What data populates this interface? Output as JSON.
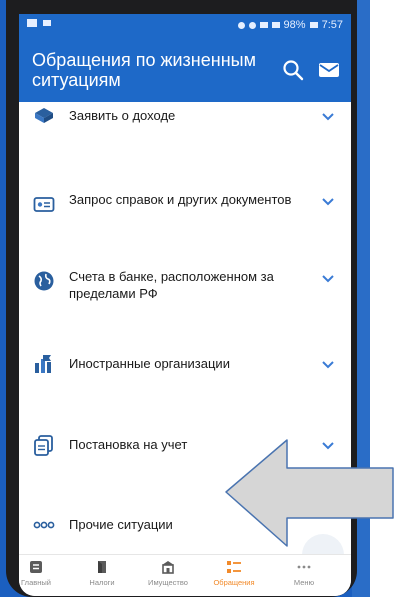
{
  "status_bar": {
    "battery": "98%",
    "time": "7:57"
  },
  "app_bar": {
    "title": "Обращения по жизненным ситуациям"
  },
  "items": [
    {
      "label": "Заявить о доходе",
      "icon": "coin-stack-icon"
    },
    {
      "label": "Запрос справок и других документов",
      "icon": "id-card-icon"
    },
    {
      "label": "Счета в банке, расположенном за пределами РФ",
      "icon": "globe-icon"
    },
    {
      "label": "Иностранные организации",
      "icon": "flag-building-icon"
    },
    {
      "label": "Постановка на учет",
      "icon": "document-copy-icon"
    },
    {
      "label": "Прочие ситуации",
      "icon": "more-dots-icon"
    }
  ],
  "tabs": [
    {
      "label": "Главный",
      "icon": "home-icon",
      "active": false
    },
    {
      "label": "Налоги",
      "icon": "tax-icon",
      "active": false
    },
    {
      "label": "Имущество",
      "icon": "property-icon",
      "active": false
    },
    {
      "label": "Обращения",
      "icon": "requests-icon",
      "active": true
    },
    {
      "label": "Меню",
      "icon": "menu-dots-icon",
      "active": false
    }
  ],
  "colors": {
    "brand": "#1e69c8",
    "active_tab": "#f28a2a",
    "chevron": "#3a7bd5"
  }
}
